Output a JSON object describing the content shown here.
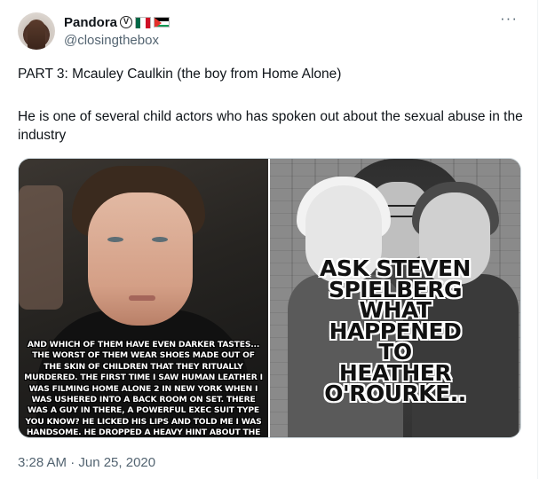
{
  "author": {
    "display_name": "Pandora",
    "handle": "@closingthebox",
    "avatar": "avatar"
  },
  "menu_icon": "more-dots-icon",
  "tweet": {
    "line1": "PART 3: Mcauley Caulkin (the boy from Home Alone)",
    "line2": "He is one of several child actors who has spoken out about the sexual abuse in the industry"
  },
  "media": {
    "left_overlay": "AND WHICH OF THEM HAVE EVEN DARKER TASTES... THE WORST OF THEM WEAR SHOES MADE OUT OF THE SKIN OF CHILDREN THAT THEY RITUALLY MURDERED. THE FIRST TIME I SAW HUMAN LEATHER I WAS FILMING HOME ALONE 2 IN NEW YORK WHEN I WAS USHERED INTO A BACK ROOM ON SET. THERE WAS A GUY IN THERE, A POWERFUL EXEC SUIT TYPE YOU KNOW? HE LICKED HIS LIPS AND TOLD ME I WAS HANDSOME. HE DROPPED A HEAVY HINT ABOUT THE ORIGIN OF THE SKIN USED TO MAKE HIS SHOES. HE ASKED ME IF I",
    "right_caption_lines": [
      "ASK STEVEN",
      "SPIELBERG",
      "WHAT",
      "HAPPENED",
      "TO",
      "HEATHER",
      "O'ROURKE.."
    ]
  },
  "timestamp": "3:28 AM · Jun 25, 2020"
}
